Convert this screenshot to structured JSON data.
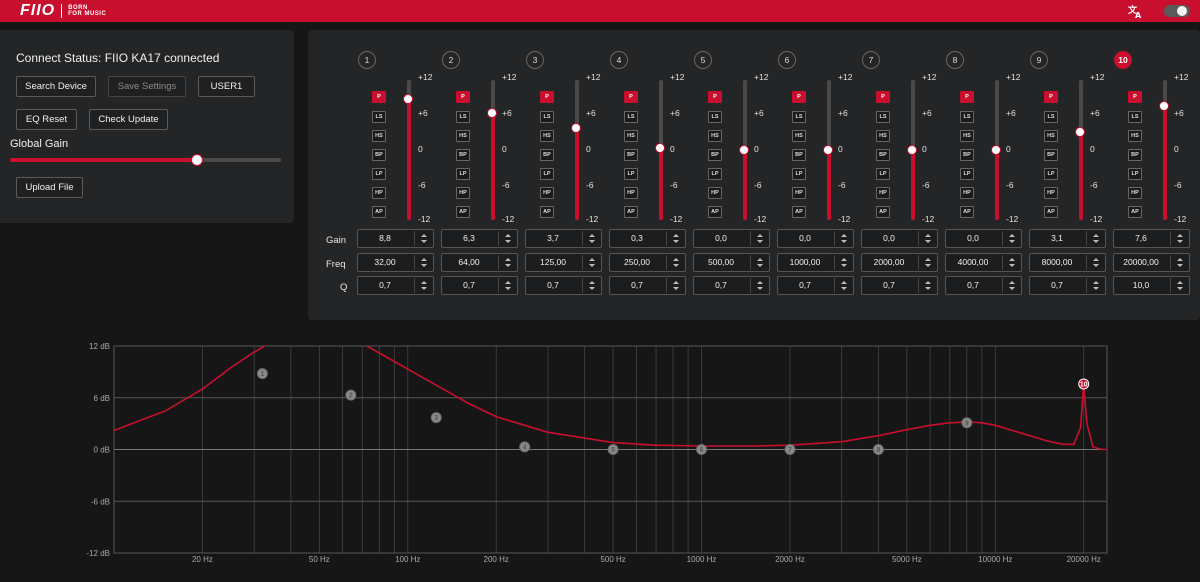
{
  "header": {
    "logo_text": "FIIO",
    "tagline_1": "BORN",
    "tagline_2": "FOR MUSIC",
    "translate_icon": "translate-icon",
    "theme_icon": "theme-toggle-icon",
    "brand_color": "#c8102e"
  },
  "left": {
    "status": "Connect Status: FIIO KA17 connected",
    "search_device": "Search Device",
    "save_settings": "Save Settings",
    "user_preset": "USER1",
    "eq_reset": "EQ Reset",
    "check_update": "Check Update",
    "global_gain_label": "Global Gain",
    "global_gain_fraction": 0.69,
    "upload_file": "Upload File"
  },
  "eq": {
    "row_labels": {
      "gain": "Gain",
      "freq": "Freq",
      "q": "Q"
    },
    "scale_labels": [
      "+12",
      "+6",
      "0",
      "-6",
      "-12"
    ],
    "filter_types": [
      "P",
      "LS",
      "HS",
      "BP",
      "LP",
      "HP",
      "AP"
    ],
    "bands": [
      {
        "num": "1",
        "gain": "8,8",
        "freq": "32,00",
        "q": "0,7",
        "type": "P",
        "gain_value": 8.8,
        "active": false
      },
      {
        "num": "2",
        "gain": "6,3",
        "freq": "64,00",
        "q": "0,7",
        "type": "P",
        "gain_value": 6.3,
        "active": false
      },
      {
        "num": "3",
        "gain": "3,7",
        "freq": "125,00",
        "q": "0,7",
        "type": "P",
        "gain_value": 3.7,
        "active": false
      },
      {
        "num": "4",
        "gain": "0,3",
        "freq": "250,00",
        "q": "0,7",
        "type": "P",
        "gain_value": 0.3,
        "active": false
      },
      {
        "num": "5",
        "gain": "0,0",
        "freq": "500,00",
        "q": "0,7",
        "type": "P",
        "gain_value": 0.0,
        "active": false
      },
      {
        "num": "6",
        "gain": "0,0",
        "freq": "1000,00",
        "q": "0,7",
        "type": "P",
        "gain_value": 0.0,
        "active": false
      },
      {
        "num": "7",
        "gain": "0,0",
        "freq": "2000,00",
        "q": "0,7",
        "type": "P",
        "gain_value": 0.0,
        "active": false
      },
      {
        "num": "8",
        "gain": "0,0",
        "freq": "4000,00",
        "q": "0,7",
        "type": "P",
        "gain_value": 0.0,
        "active": false
      },
      {
        "num": "9",
        "gain": "3,1",
        "freq": "8000,00",
        "q": "0,7",
        "type": "P",
        "gain_value": 3.1,
        "active": false
      },
      {
        "num": "10",
        "gain": "7,6",
        "freq": "20000,00",
        "q": "10,0",
        "type": "P",
        "gain_value": 7.6,
        "active": true
      }
    ]
  },
  "chart_data": {
    "type": "line",
    "x_scale": "log",
    "xlim": [
      10,
      24000
    ],
    "ylim": [
      -12,
      12
    ],
    "x_ticks": [
      {
        "label": "20 Hz",
        "value": 20
      },
      {
        "label": "50 Hz",
        "value": 50
      },
      {
        "label": "100 Hz",
        "value": 100
      },
      {
        "label": "200 Hz",
        "value": 200
      },
      {
        "label": "500 Hz",
        "value": 500
      },
      {
        "label": "1000 Hz",
        "value": 1000
      },
      {
        "label": "2000 Hz",
        "value": 2000
      },
      {
        "label": "5000 Hz",
        "value": 5000
      },
      {
        "label": "10000 Hz",
        "value": 10000
      },
      {
        "label": "20000 Hz",
        "value": 20000
      }
    ],
    "y_ticks": [
      {
        "label": "12 dB",
        "value": 12
      },
      {
        "label": "6 dB",
        "value": 6
      },
      {
        "label": "0 dB",
        "value": 0
      },
      {
        "label": "-6 dB",
        "value": -6
      },
      {
        "label": "-12 dB",
        "value": -12
      }
    ],
    "band_points": [
      {
        "label": "1",
        "x": 32,
        "y": 8.8
      },
      {
        "label": "2",
        "x": 64,
        "y": 6.3
      },
      {
        "label": "3",
        "x": 125,
        "y": 3.7
      },
      {
        "label": "4",
        "x": 250,
        "y": 0.3
      },
      {
        "label": "5",
        "x": 500,
        "y": 0.0
      },
      {
        "label": "6",
        "x": 1000,
        "y": 0.0
      },
      {
        "label": "7",
        "x": 2000,
        "y": 0.0
      },
      {
        "label": "8",
        "x": 4000,
        "y": 0.0
      },
      {
        "label": "9",
        "x": 8000,
        "y": 3.1
      },
      {
        "label": "10",
        "x": 20000,
        "y": 7.6
      }
    ],
    "series": [
      {
        "color": "#c8102e",
        "x": [
          10,
          15,
          20,
          25,
          30,
          35,
          40,
          50,
          60,
          70,
          90,
          120,
          160,
          200,
          300,
          500,
          700,
          1000,
          1500,
          2000,
          3000,
          4000,
          5000,
          6000,
          7000,
          8000,
          9000,
          10000,
          12000,
          15000,
          17000,
          18500,
          19500,
          20000,
          20500,
          21500,
          23000,
          24000
        ],
        "y": [
          2.2,
          4.5,
          7.0,
          9.5,
          11.3,
          12.6,
          13.3,
          13.7,
          13.2,
          12.3,
          10.2,
          7.8,
          5.4,
          3.8,
          2.0,
          0.8,
          0.5,
          0.4,
          0.4,
          0.5,
          0.9,
          1.6,
          2.3,
          2.8,
          3.1,
          3.2,
          3.1,
          2.8,
          2.0,
          1.0,
          0.6,
          0.6,
          2.5,
          7.6,
          3.0,
          0.3,
          0.0,
          0.0
        ]
      }
    ]
  }
}
